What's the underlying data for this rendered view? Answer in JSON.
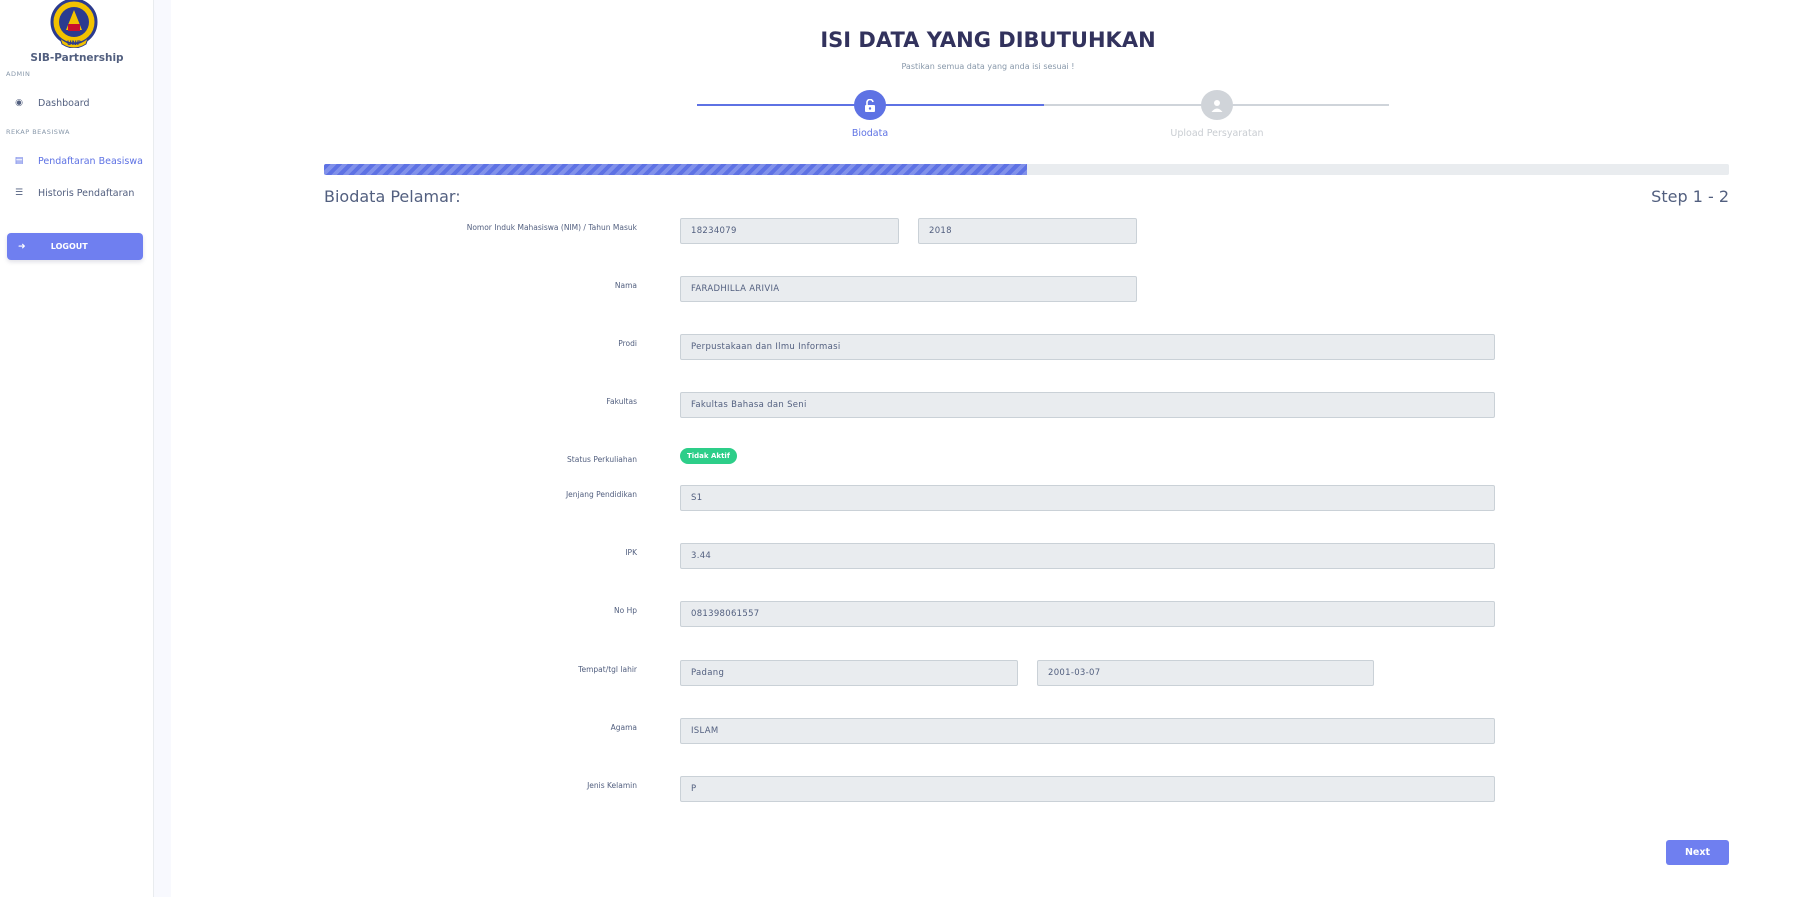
{
  "sidebar": {
    "brand": "SIB-Partnership",
    "heading_admin": "ADMIN",
    "heading_rekap": "REKAP BEASISWA",
    "items": [
      {
        "label": "Dashboard",
        "icon": "palette-icon"
      },
      {
        "label": "Pendaftaran Beasiswa",
        "icon": "scroll-icon"
      },
      {
        "label": "Historis Pendaftaran",
        "icon": "list-icon"
      }
    ],
    "logout_label": "LOGOUT"
  },
  "header": {
    "title": "ISI DATA YANG DIBUTUHKAN",
    "subtitle": "Pastikan semua data yang anda isi sesuai !"
  },
  "steps": [
    {
      "label": "Biodata",
      "state": "active",
      "icon": "unlock-icon"
    },
    {
      "label": "Upload Persyaratan",
      "state": "inactive",
      "icon": "user-icon"
    }
  ],
  "progress": {
    "percent": 50
  },
  "form": {
    "section_title": "Biodata Pelamar:",
    "step_count": "Step 1 - 2",
    "nim_label": "Nomor Induk Mahasiswa (NIM) / Tahun Masuk",
    "nim_value": "18234079",
    "tahun_masuk_value": "2018",
    "nama_label": "Nama",
    "nama_value": "FARADHILLA ARIVIA",
    "prodi_label": "Prodi",
    "prodi_value": "Perpustakaan dan Ilmu Informasi",
    "fakultas_label": "Fakultas",
    "fakultas_value": "Fakultas Bahasa dan Seni",
    "status_label": "Status Perkuliahan",
    "status_value": "Tidak Aktif",
    "jenjang_label": "Jenjang Pendidikan",
    "jenjang_value": "S1",
    "ipk_label": "IPK",
    "ipk_value": "3.44",
    "nohp_label": "No Hp",
    "nohp_value": "081398061557",
    "ttl_label": "Tempat/tgl lahir",
    "tempat_value": "Padang",
    "tanggal_value": "2001-03-07",
    "agama_label": "Agama",
    "agama_value": "ISLAM",
    "jk_label": "Jenis Kelamin",
    "jk_value": "P"
  },
  "next_label": "Next",
  "colors": {
    "primary": "#5e72e4",
    "success": "#2dce89",
    "input_bg": "#e9ecef"
  }
}
